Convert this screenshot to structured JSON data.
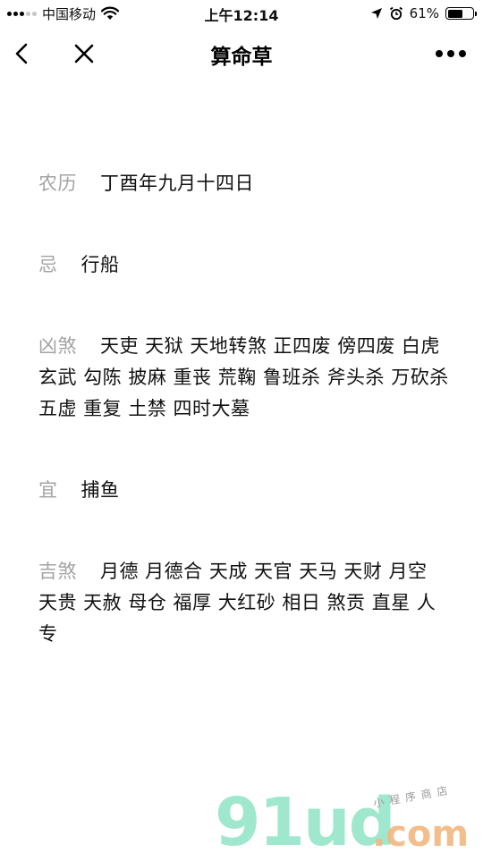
{
  "status_bar": {
    "carrier": "中国移动",
    "time": "上午12:14",
    "battery_text": "61%",
    "battery_level": 0.61,
    "icons": [
      "signal-dots-icon",
      "wifi-icon",
      "location-arrow-icon",
      "alarm-clock-icon",
      "battery-icon"
    ]
  },
  "nav": {
    "title": "算命草",
    "icons": [
      "back-chevron-icon",
      "close-x-icon",
      "more-dots-icon"
    ]
  },
  "entries": [
    {
      "label": "农历",
      "value": "丁酉年九月十四日"
    },
    {
      "label": "忌",
      "value": "行船"
    },
    {
      "label": "凶煞",
      "value": "天吏 天狱 天地转煞 正四废 傍四废 白虎 玄武 勾陈 披麻 重丧 荒鞠 鲁班杀 斧头杀 万砍杀 五虚 重复 土禁 四时大墓"
    },
    {
      "label": "宜",
      "value": "捕鱼"
    },
    {
      "label": "吉煞",
      "value": "月德 月德合 天成 天官 天马 天财 月空 天贵 天赦 母仓 福厚 大红砂 相日 煞贡 直星 人专"
    }
  ],
  "watermark": {
    "main": "91ud",
    "tld": ".com",
    "sub": "小程序商店"
  }
}
